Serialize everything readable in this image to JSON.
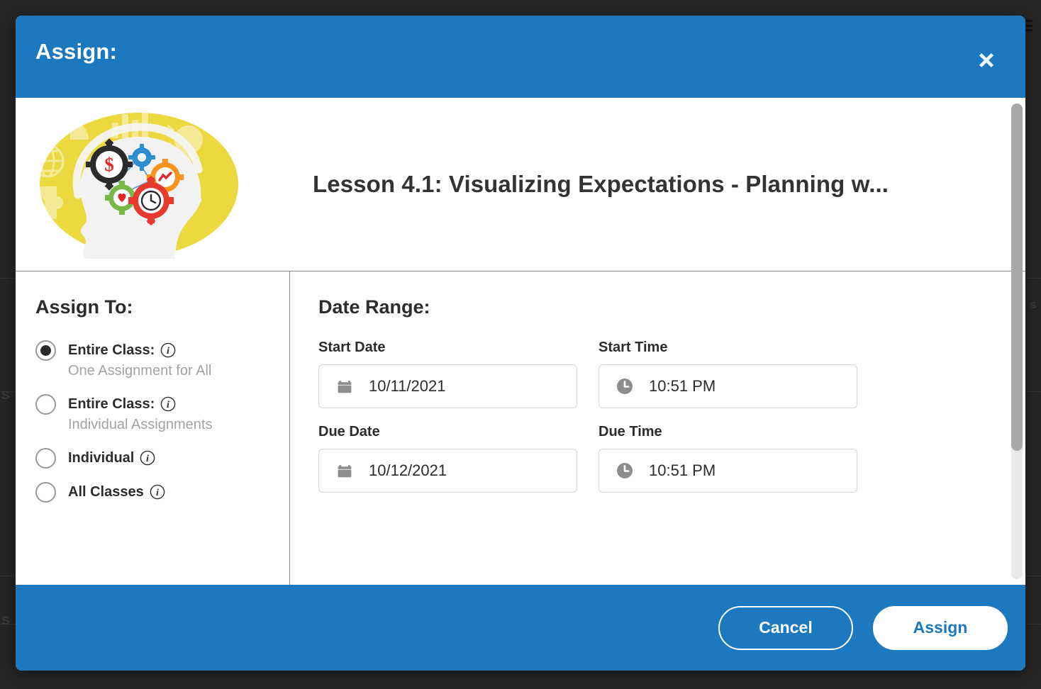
{
  "background": {
    "ghost_texts": [
      "S",
      "S",
      "s"
    ]
  },
  "modal": {
    "header": {
      "title": "Assign:",
      "close_icon": "close-icon"
    },
    "lesson": {
      "thumbnail_icon": "brain-gears-thumbnail",
      "title": "Lesson 4.1: Visualizing Expectations - Planning w..."
    },
    "assign_to": {
      "heading": "Assign To:",
      "options": [
        {
          "label": "Entire Class:",
          "sublabel": "One Assignment for All",
          "selected": true,
          "info_icon": "info-icon"
        },
        {
          "label": "Entire Class:",
          "sublabel": "Individual Assignments",
          "selected": false,
          "info_icon": "info-icon"
        },
        {
          "label": "Individual",
          "sublabel": "",
          "selected": false,
          "info_icon": "info-icon"
        },
        {
          "label": "All Classes",
          "sublabel": "",
          "selected": false,
          "info_icon": "info-icon"
        }
      ]
    },
    "date_range": {
      "heading": "Date Range:",
      "fields": [
        {
          "label": "Start Date",
          "value": "10/11/2021",
          "icon": "calendar-icon"
        },
        {
          "label": "Start Time",
          "value": "10:51 PM",
          "icon": "clock-icon"
        },
        {
          "label": "Due Date",
          "value": "10/12/2021",
          "icon": "calendar-icon"
        },
        {
          "label": "Due Time",
          "value": "10:51 PM",
          "icon": "clock-icon"
        }
      ]
    },
    "footer": {
      "cancel_label": "Cancel",
      "assign_label": "Assign"
    }
  },
  "colors": {
    "brand_blue": "#1c79bf",
    "thumb_yellow": "#ecd93f",
    "text_dark": "#2c2c2c",
    "text_muted": "#a2a2a2",
    "border_light": "#d6d6d6",
    "scrollbar_thumb": "#a8a8a8"
  }
}
